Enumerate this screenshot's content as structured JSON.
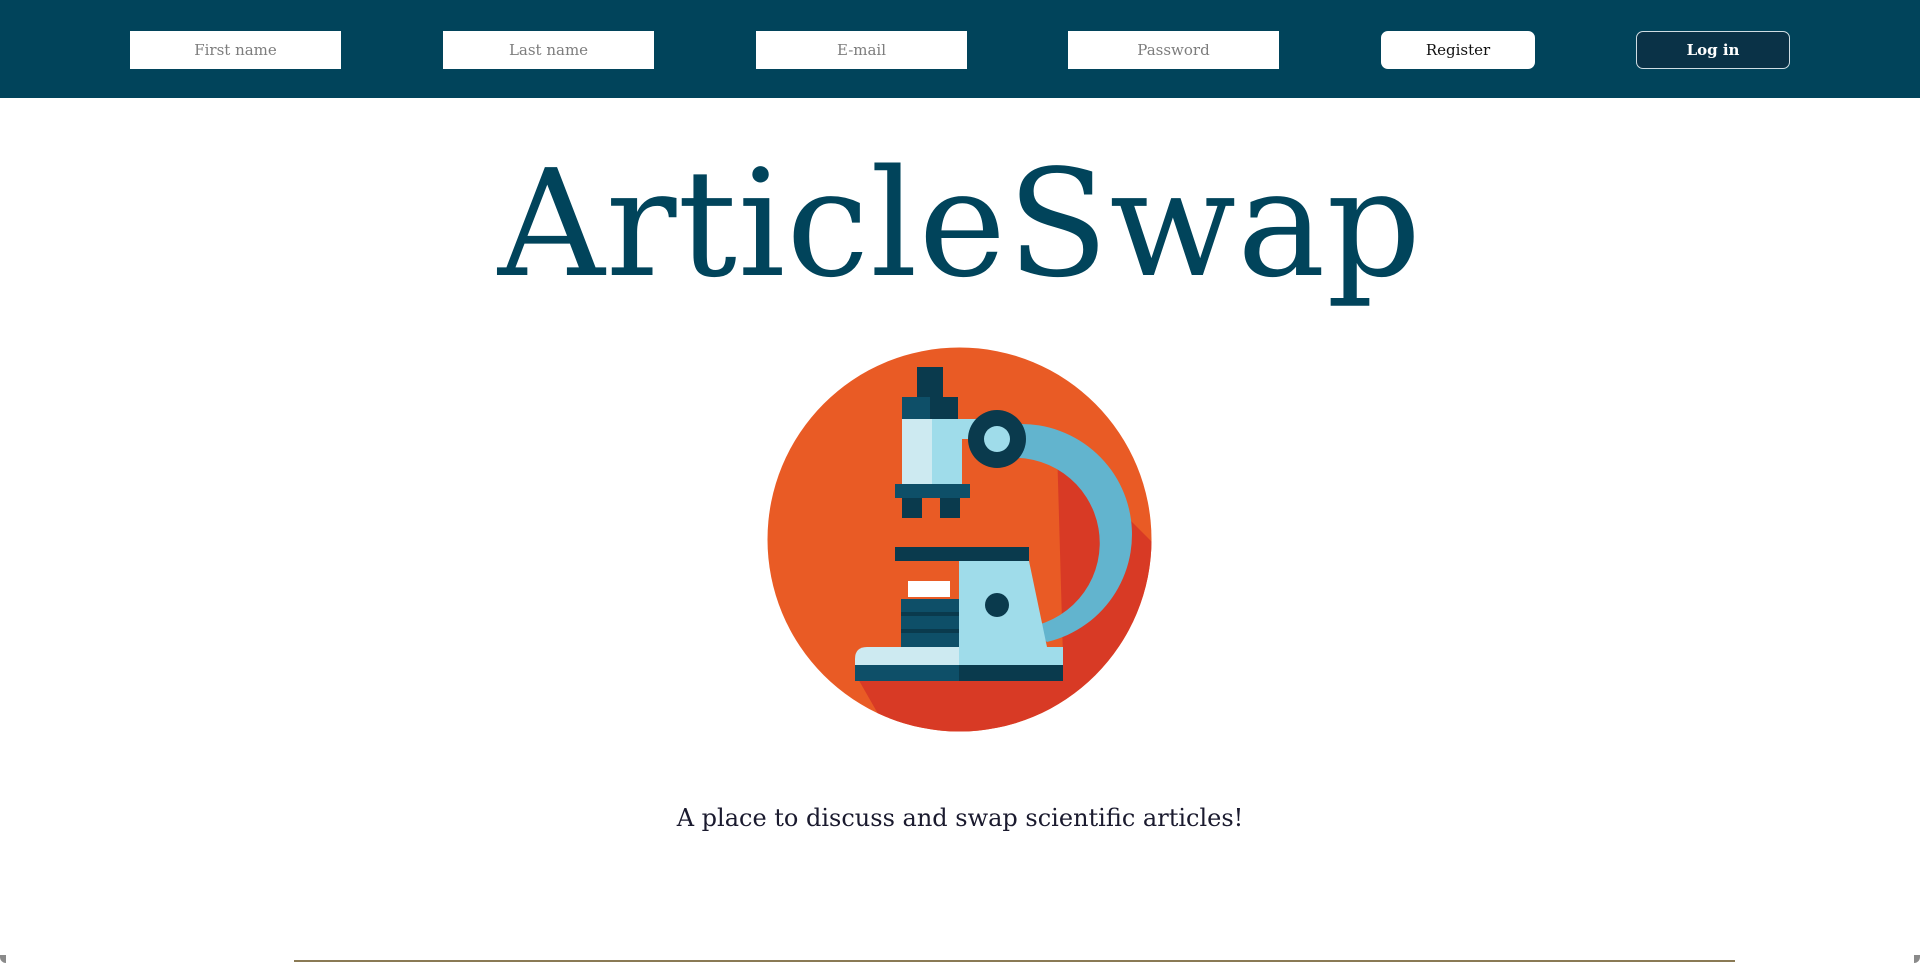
{
  "header": {
    "first_name_placeholder": "First name",
    "last_name_placeholder": "Last name",
    "email_placeholder": "E-mail",
    "password_placeholder": "Password",
    "register_label": "Register",
    "login_label": "Log in"
  },
  "main": {
    "title": "ArticleSwap",
    "logo_icon": "microscope-icon",
    "tagline": "A place to discuss and swap scientific articles!"
  },
  "colors": {
    "brand_dark_teal": "#01445b",
    "logo_orange": "#e95b25",
    "logo_red_shadow": "#d83a25",
    "microscope_light_blue": "#9fdcea",
    "microscope_blue": "#62b4ce"
  }
}
